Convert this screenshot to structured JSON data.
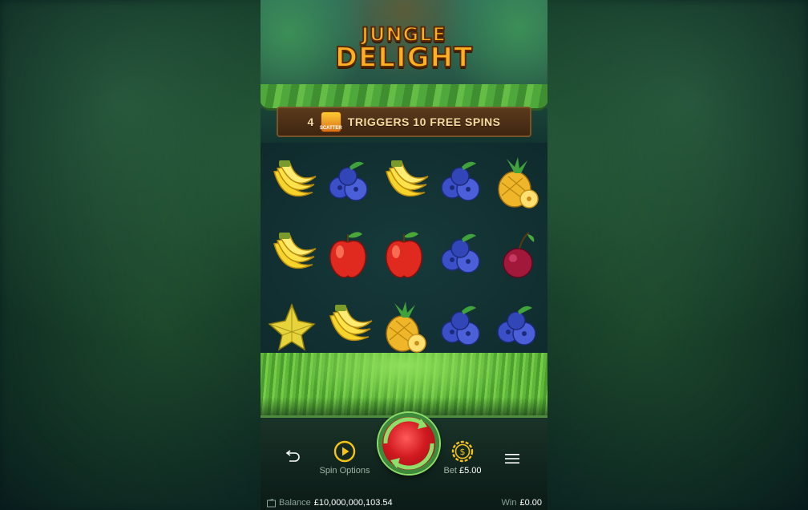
{
  "game": {
    "logo": {
      "line1": "JUNGLE",
      "line2": "DELIGHT"
    },
    "banner": {
      "count": "4",
      "scatter_badge": "SCATTER",
      "text": "TRIGGERS 10 FREE SPINS"
    },
    "reels": [
      [
        "banana",
        "blueberry",
        "banana",
        "blueberry",
        "pineapple"
      ],
      [
        "banana",
        "apple",
        "apple",
        "blueberry",
        "plum"
      ],
      [
        "starfruit",
        "banana",
        "pineapple",
        "blueberry",
        "blueberry"
      ]
    ]
  },
  "controls": {
    "back_icon": "undo-arrow-icon",
    "spin_options_label": "Spin Options",
    "spin_button_icon": "spin-icon",
    "bet_label": "Bet",
    "bet_value": "£5.00",
    "menu_icon": "hamburger-icon"
  },
  "footer": {
    "balance_label": "Balance",
    "balance_value": "£10,000,000,103.54",
    "win_label": "Win",
    "win_value": "£0.00"
  },
  "colors": {
    "accent_gold": "#f7c31a",
    "spin_red": "#d11a20",
    "bar_green": "#4f8c3f"
  }
}
